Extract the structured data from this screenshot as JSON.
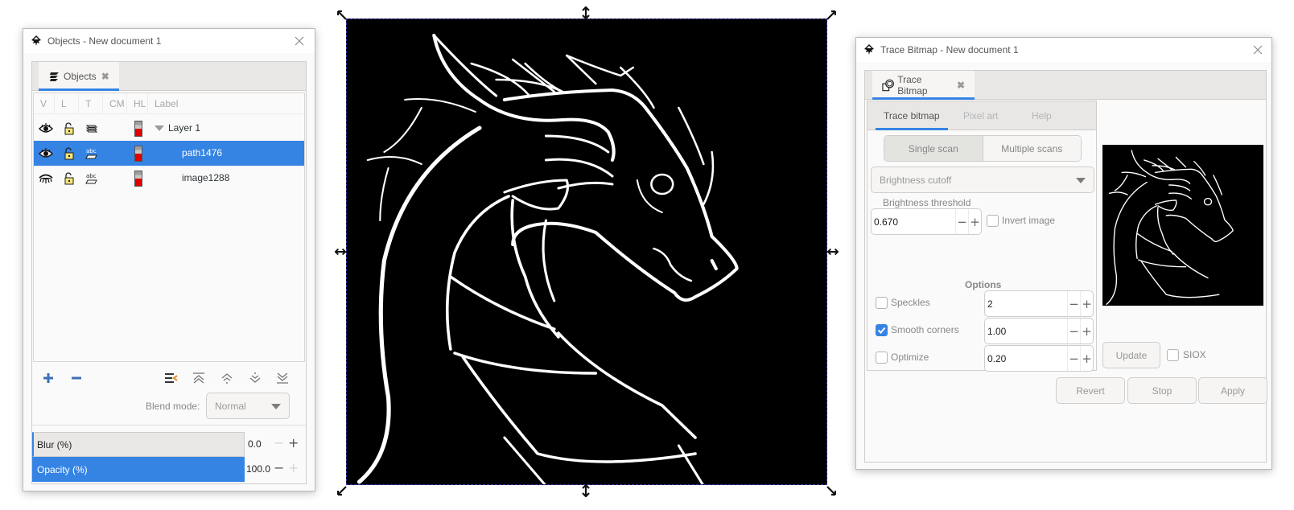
{
  "objects_window": {
    "title": "Objects - New document 1",
    "tab_label": "Objects",
    "columns": [
      "V",
      "L",
      "T",
      "CM",
      "HL",
      "Label"
    ],
    "rows": [
      {
        "label": "Layer 1",
        "type": "layer",
        "visible": true,
        "locked": false,
        "expanded": true,
        "selected": false,
        "highlight_color": "#e00000"
      },
      {
        "label": "path1476",
        "type": "path",
        "visible": true,
        "locked": false,
        "selected": true,
        "highlight_color": "#e00000"
      },
      {
        "label": "image1288",
        "type": "image",
        "visible": false,
        "locked": false,
        "selected": false,
        "highlight_color": "#e00000"
      }
    ],
    "toolbar_icons": [
      "add-icon",
      "remove-icon",
      "layer-menu-icon",
      "raise-to-top-icon",
      "raise-icon",
      "lower-icon",
      "lower-to-bottom-icon"
    ],
    "blend_mode_label": "Blend mode:",
    "blend_mode_value": "Normal",
    "blur_label": "Blur (%)",
    "blur_value": "0.0",
    "opacity_label": "Opacity (%)",
    "opacity_value": "100.0"
  },
  "canvas": {
    "description": "Dragon head line art (white strokes on black background), selected with scale handles"
  },
  "trace_window": {
    "title": "Trace Bitmap - New document 1",
    "tab_label": "Trace Bitmap",
    "subtabs": [
      "Trace bitmap",
      "Pixel art",
      "Help"
    ],
    "active_subtab": "Trace bitmap",
    "scan_modes": [
      "Single scan",
      "Multiple scans"
    ],
    "active_scan_mode": "Single scan",
    "detection_mode": "Brightness cutoff",
    "threshold_label": "Brightness threshold",
    "threshold_value": "0.670",
    "invert_label": "Invert image",
    "invert_checked": false,
    "options_heading": "Options",
    "options": [
      {
        "label": "Speckles",
        "checked": false,
        "value": "2"
      },
      {
        "label": "Smooth corners",
        "checked": true,
        "value": "1.00"
      },
      {
        "label": "Optimize",
        "checked": false,
        "value": "0.20"
      }
    ],
    "update_label": "Update",
    "siox_label": "SIOX",
    "siox_checked": false,
    "buttons": {
      "revert": "Revert",
      "stop": "Stop",
      "apply": "Apply"
    }
  },
  "colors": {
    "accent": "#3584e4",
    "canvas_bg": "#000000",
    "stroke": "#ffffff"
  }
}
